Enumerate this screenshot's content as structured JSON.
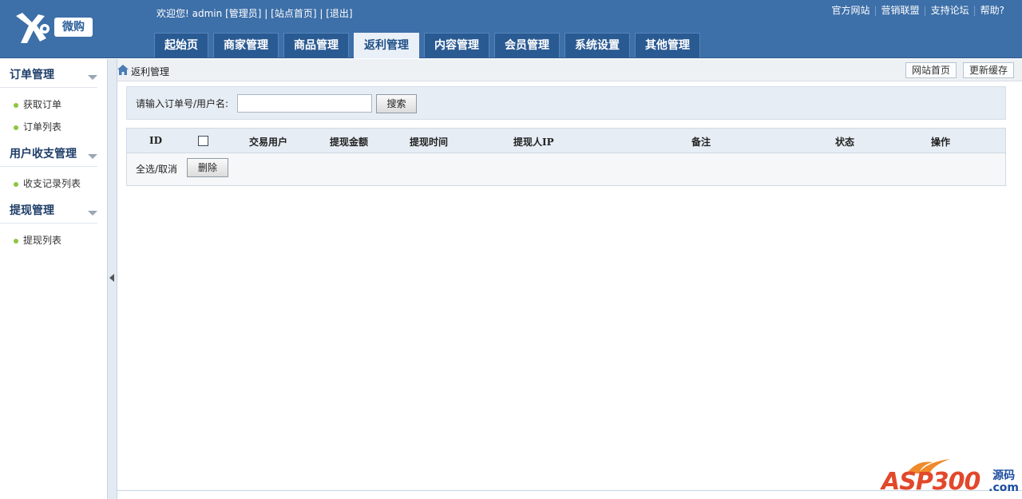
{
  "header": {
    "logo_text": "微购",
    "welcome": {
      "greeting": "欢迎您!",
      "user": "admin",
      "role": "[管理员]",
      "sep": "|",
      "home_link": "[站点首页]",
      "logout_link": "[退出]"
    },
    "top_links": [
      "官方网站",
      "营销联盟",
      "支持论坛",
      "帮助?"
    ],
    "tabs": [
      {
        "label": "起始页",
        "active": false
      },
      {
        "label": "商家管理",
        "active": false
      },
      {
        "label": "商品管理",
        "active": false
      },
      {
        "label": "返利管理",
        "active": true
      },
      {
        "label": "内容管理",
        "active": false
      },
      {
        "label": "会员管理",
        "active": false
      },
      {
        "label": "系统设置",
        "active": false
      },
      {
        "label": "其他管理",
        "active": false
      }
    ]
  },
  "sidebar": {
    "groups": [
      {
        "title": "订单管理",
        "items": [
          "获取订单",
          "订单列表"
        ]
      },
      {
        "title": "用户收支管理",
        "items": [
          "收支记录列表"
        ]
      },
      {
        "title": "提现管理",
        "items": [
          "提现列表"
        ]
      }
    ]
  },
  "breadcrumb": {
    "current": "返利管理",
    "site_home_button": "网站首页",
    "refresh_cache_button": "更新缓存"
  },
  "search": {
    "label": "请输入订单号/用户名:",
    "value": "",
    "button": "搜索"
  },
  "table": {
    "columns": [
      "ID",
      "交易用户",
      "提现金额",
      "提现时间",
      "提现人IP",
      "备注",
      "状态",
      "操作"
    ],
    "rows": [],
    "select_all_label": "全选/取消",
    "delete_button": "删除"
  },
  "watermark": {
    "brand": "ASP300",
    "side_top": "源码",
    "side_bottom": ".com"
  },
  "colors": {
    "header_bg": "#3d6fa8",
    "tab_active_bg": "#eaf0f7",
    "accent_dot": "#8cc63f",
    "watermark_red": "#e2482b"
  }
}
